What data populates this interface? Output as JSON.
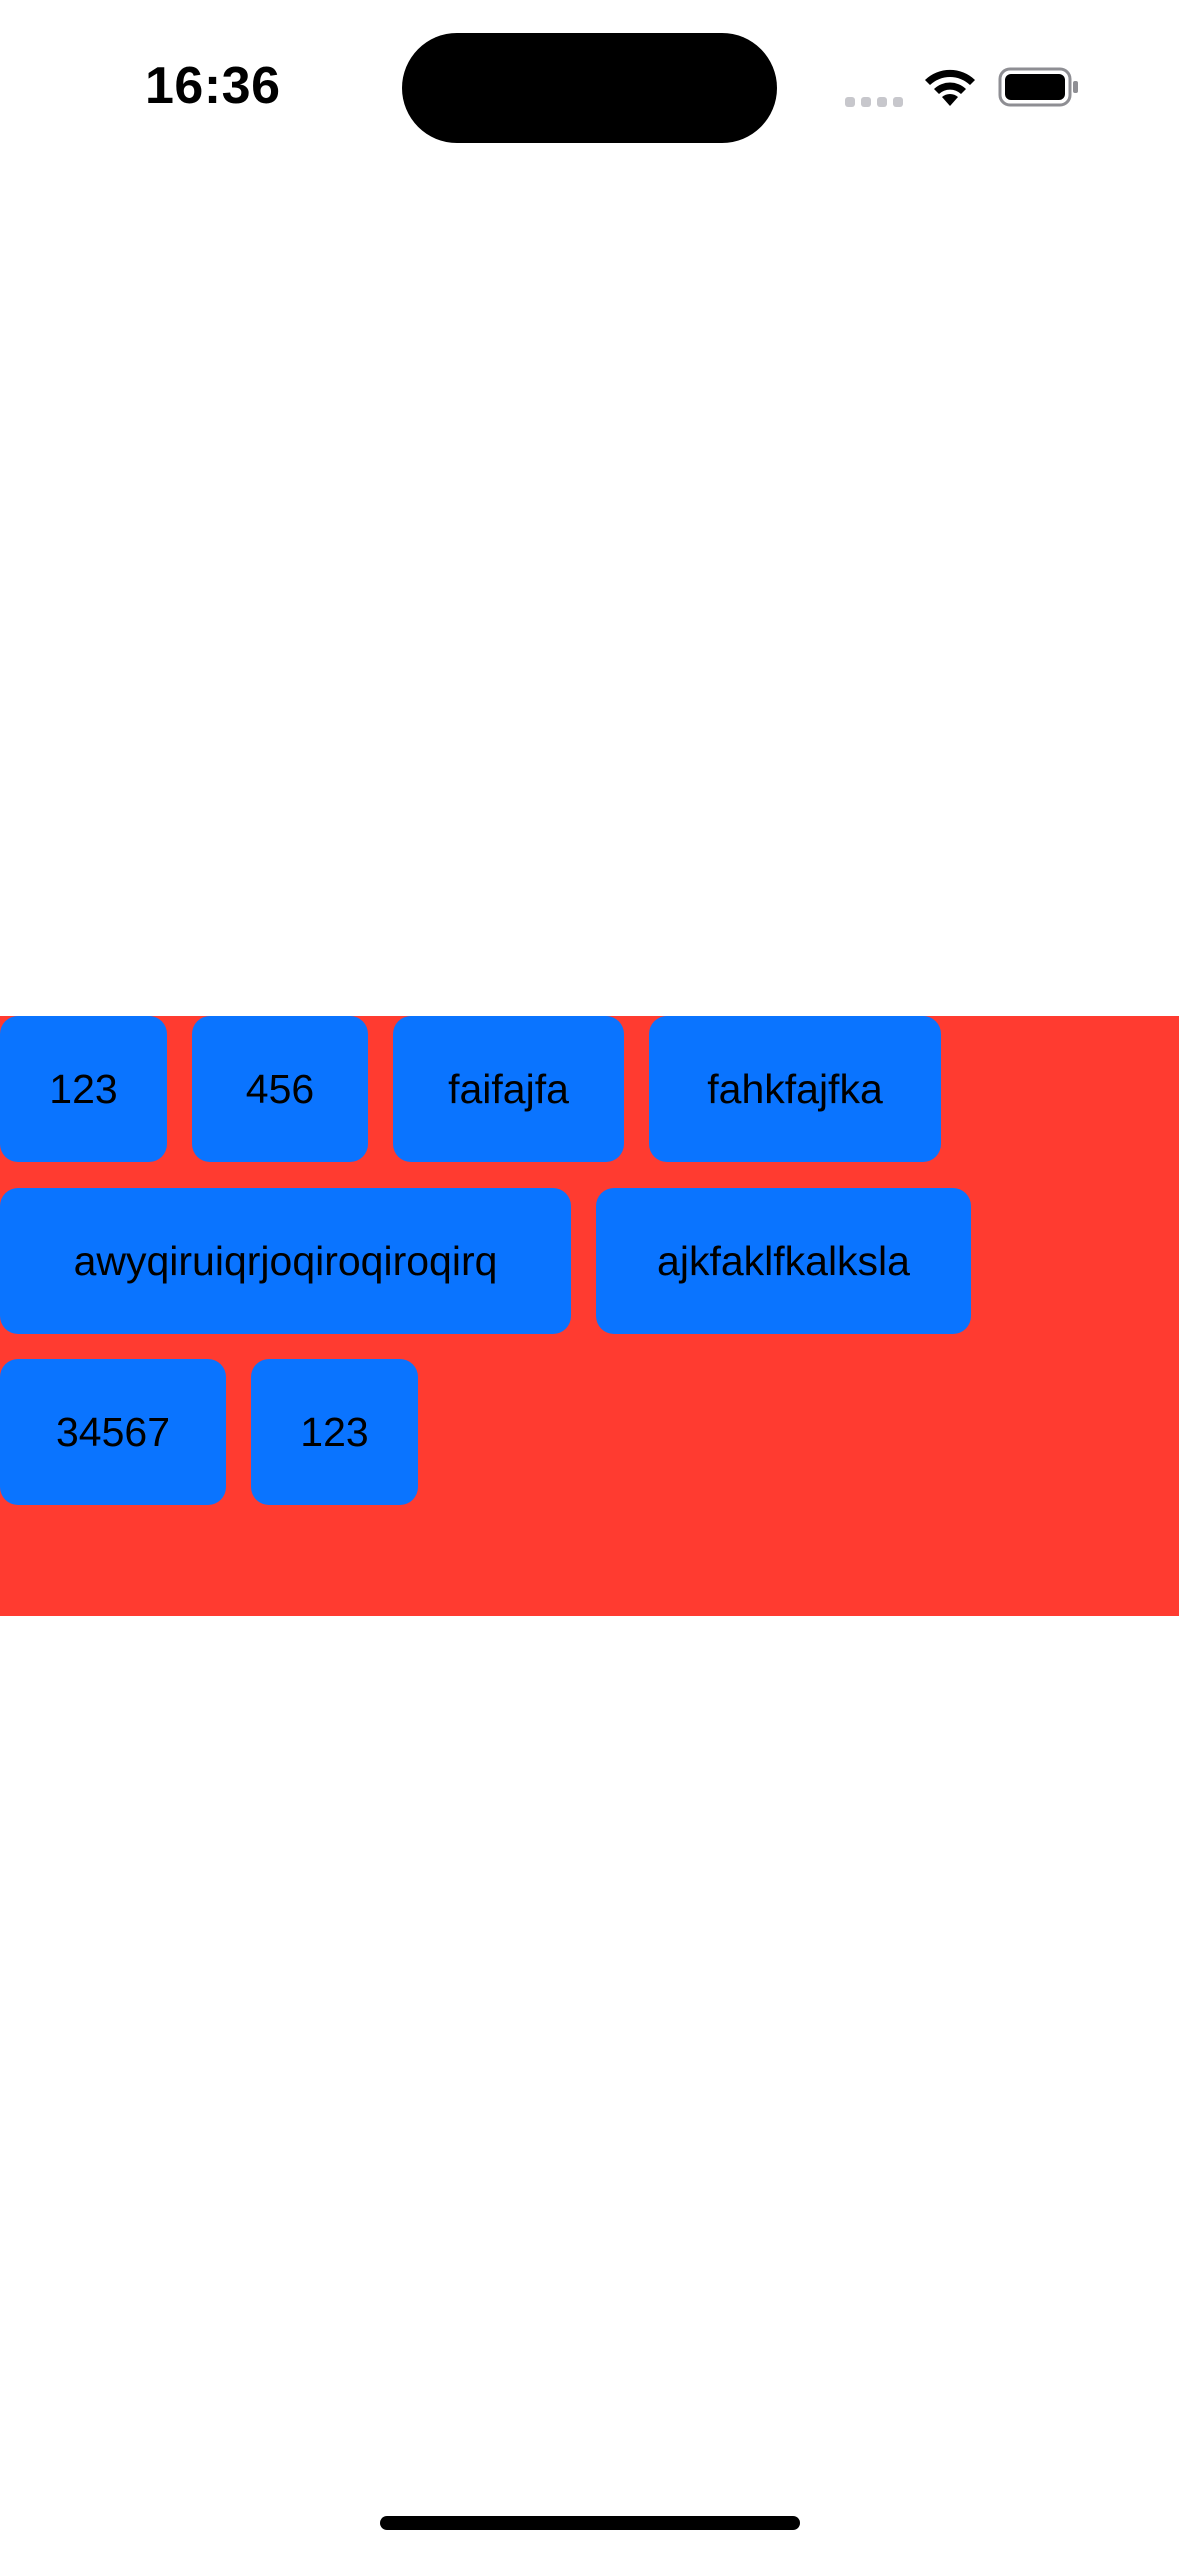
{
  "status_bar": {
    "time": "16:36",
    "wifi_icon": "wifi-icon",
    "battery_icon": "battery-icon",
    "signal_icon": "cellular-signal-icon"
  },
  "tag_panel": {
    "background_color": "#ff3b30",
    "tag_color": "#0a74ff",
    "tags": [
      "123",
      "456",
      "faifajfa",
      "fahkfajfka",
      "awyqiruiqrjoqiroqiroqirq",
      "ajkfaklfkalksla",
      "34567",
      "123"
    ]
  }
}
